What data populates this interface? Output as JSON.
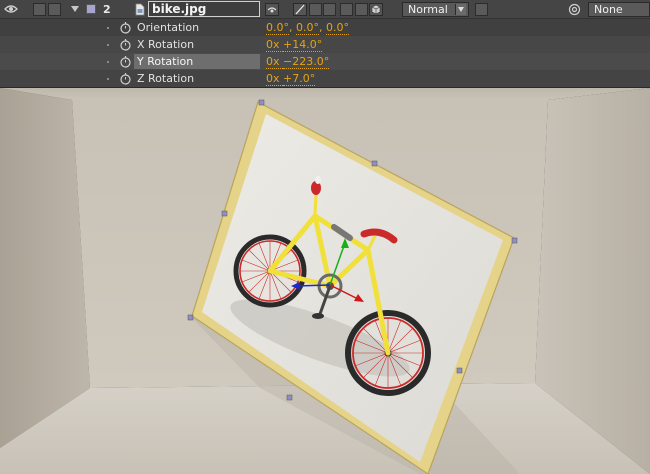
{
  "layer": {
    "number": "2",
    "name": "bike.jpg",
    "blend_mode": "Normal",
    "parent": "None",
    "label_color": "#a7a5d0"
  },
  "properties": [
    {
      "name": "Orientation",
      "value_parts": [
        "0.0°",
        ", ",
        "0.0°",
        ", ",
        "0.0°"
      ]
    },
    {
      "name": "X Rotation",
      "value_parts": [
        "0x ",
        "+14.0°"
      ]
    },
    {
      "name": "Y Rotation",
      "value_parts": [
        "0x ",
        "−223.0°"
      ]
    },
    {
      "name": "Z Rotation",
      "value_parts": [
        "0x ",
        "+7.0°"
      ]
    }
  ],
  "colors": {
    "value_orange": "#e5a312",
    "frame_gold": "#e0c870",
    "bike_yellow": "#f2e03a",
    "bike_red": "#cc2a2a",
    "axis_x": "#d01818",
    "axis_y": "#18b018",
    "axis_z": "#1a2ad0"
  },
  "icons": [
    "eye-icon",
    "expand-triangle-icon",
    "label-color-swatch",
    "file-icon",
    "shy-switch-icon",
    "quality-switch-icon",
    "3d-layer-icon",
    "pickwhip-icon",
    "stopwatch-icon"
  ]
}
